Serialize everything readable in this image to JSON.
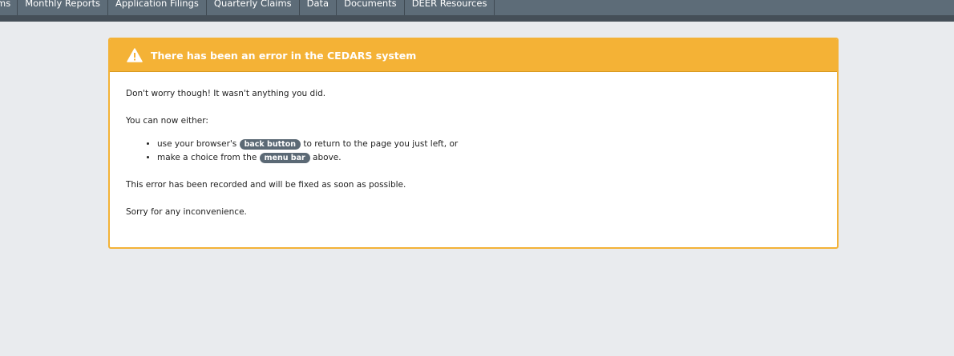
{
  "nav": {
    "items": [
      {
        "label": "ms"
      },
      {
        "label": "Monthly Reports"
      },
      {
        "label": "Application Filings"
      },
      {
        "label": "Quarterly Claims"
      },
      {
        "label": "Data"
      },
      {
        "label": "Documents"
      },
      {
        "label": "DEER Resources"
      }
    ]
  },
  "error_panel": {
    "icon": "warning-icon",
    "title": "There has been an error in the CEDARS system",
    "para1": "Don't worry though! It wasn't anything you did.",
    "para2": "You can now either:",
    "bullet1": {
      "before": "use your browser's ",
      "pill": "back button",
      "after": " to return to the page you just left, or"
    },
    "bullet2": {
      "before": "make a choice from the ",
      "pill": "menu bar",
      "after": " above."
    },
    "para3": "This error has been recorded and will be fixed as soon as possible.",
    "para4": "Sorry for any inconvenience."
  },
  "colors": {
    "navbar": "#5d6c78",
    "navbar_bottom": "#454f58",
    "panel_header": "#f4b236",
    "pill": "#5b6975",
    "background": "#e9ebee"
  }
}
